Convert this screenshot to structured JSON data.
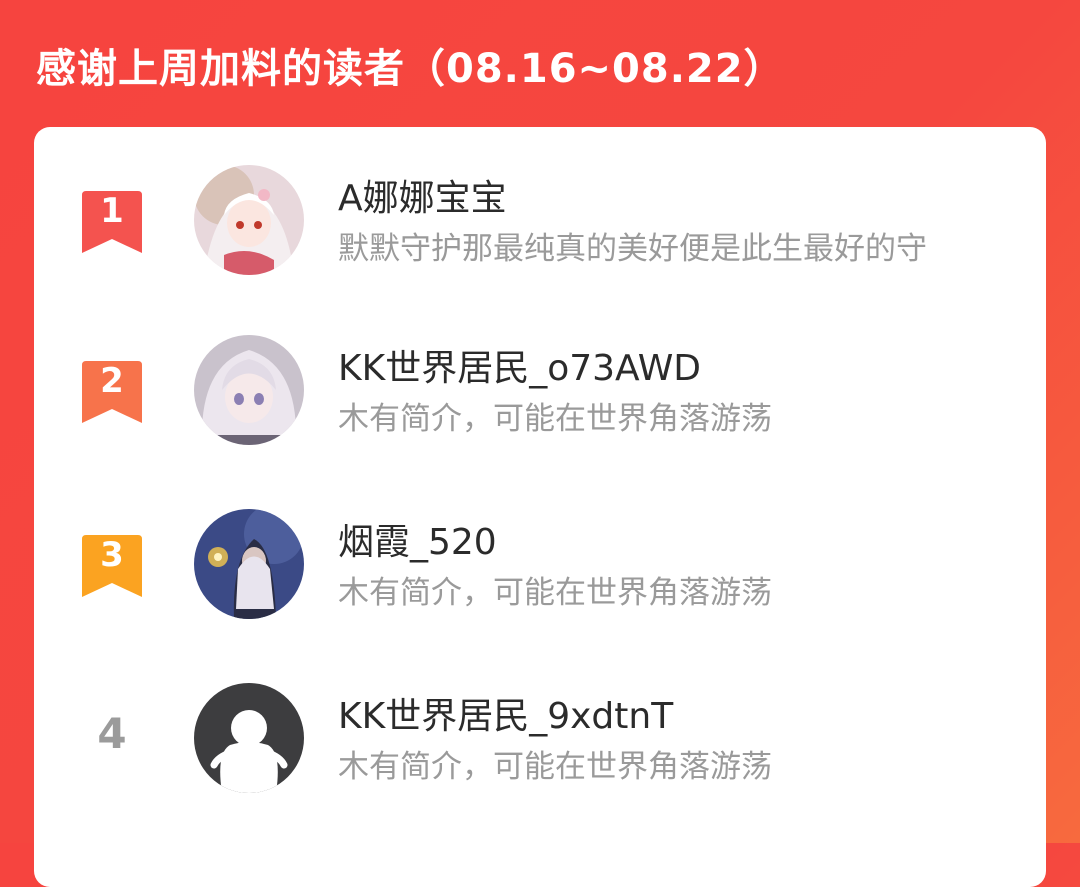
{
  "header": {
    "title": "感谢上周加料的读者（08.16~08.22）"
  },
  "readers": [
    {
      "rank": "1",
      "name": "A娜娜宝宝",
      "bio": "默默守护那最纯真的美好便是此生最好的守",
      "badge_color": "#f4534f",
      "avatar": "anime-girl-white-hair-avatar"
    },
    {
      "rank": "2",
      "name": "KK世界居民_o73AWD",
      "bio": "木有简介，可能在世界角落游荡",
      "badge_color": "#f7734b",
      "avatar": "anime-girl-silver-hair-avatar"
    },
    {
      "rank": "3",
      "name": "烟霞_520",
      "bio": "木有简介，可能在世界角落游荡",
      "badge_color": "#fba321",
      "avatar": "night-sparkler-girl-avatar"
    },
    {
      "rank": "4",
      "name": "KK世界居民_9xdtnT",
      "bio": "木有简介，可能在世界角落游荡",
      "avatar": "default-ghost-avatar"
    }
  ]
}
